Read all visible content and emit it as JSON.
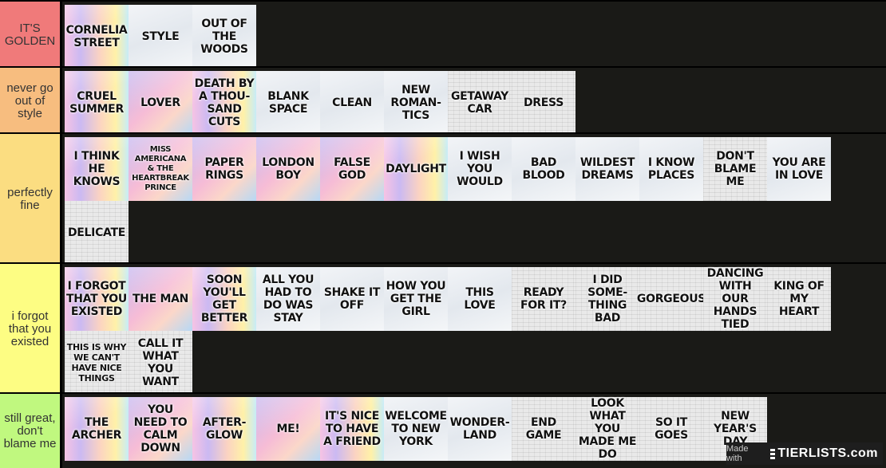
{
  "tiers": [
    {
      "label": "IT'S GOLDEN",
      "color": "#f07a7a",
      "items": [
        {
          "text": "CORNELIA STREET",
          "style": "rainbow"
        },
        {
          "text": "STYLE",
          "style": "sky"
        },
        {
          "text": "OUT OF THE WOODS",
          "style": "sky"
        }
      ]
    },
    {
      "label": "never go out of style",
      "color": "#f7bd7f",
      "items": [
        {
          "text": "CRUEL SUMMER",
          "style": "rainbow"
        },
        {
          "text": "LOVER",
          "style": "pastel"
        },
        {
          "text": "DEATH BY A THOU-SAND CUTS",
          "style": "rainbow"
        },
        {
          "text": "BLANK SPACE",
          "style": "sky"
        },
        {
          "text": "CLEAN",
          "style": "sky"
        },
        {
          "text": "NEW ROMAN-TICS",
          "style": "sky"
        },
        {
          "text": "GETAWAY CAR",
          "style": "paper"
        },
        {
          "text": "DRESS",
          "style": "paper"
        }
      ]
    },
    {
      "label": "perfectly fine",
      "color": "#fbdd81",
      "items": [
        {
          "text": "I THINK HE KNOWS",
          "style": "rainbow"
        },
        {
          "text": "MISS AMERICANA & THE HEARTBREAK PRINCE",
          "style": "pastel",
          "size": "xs"
        },
        {
          "text": "PAPER RINGS",
          "style": "pastel"
        },
        {
          "text": "LONDON BOY",
          "style": "pastel"
        },
        {
          "text": "FALSE GOD",
          "style": "pastel"
        },
        {
          "text": "DAYLIGHT",
          "style": "rainbow"
        },
        {
          "text": "I WISH YOU WOULD",
          "style": "sky"
        },
        {
          "text": "BAD BLOOD",
          "style": "sky"
        },
        {
          "text": "WILDEST DREAMS",
          "style": "sky"
        },
        {
          "text": "I KNOW PLACES",
          "style": "sky"
        },
        {
          "text": "DON'T BLAME ME",
          "style": "paper"
        },
        {
          "text": "YOU ARE IN LOVE",
          "style": "sky"
        },
        {
          "text": "DELICATE",
          "style": "paper"
        }
      ]
    },
    {
      "label": "i forgot that you existed",
      "color": "#fdfd83",
      "items": [
        {
          "text": "I FORGOT THAT YOU EXISTED",
          "style": "rainbow"
        },
        {
          "text": "THE MAN",
          "style": "pastel"
        },
        {
          "text": "SOON YOU'LL GET BETTER",
          "style": "rainbow"
        },
        {
          "text": "ALL YOU HAD TO DO WAS STAY",
          "style": "sky"
        },
        {
          "text": "SHAKE IT OFF",
          "style": "sky"
        },
        {
          "text": "HOW YOU GET THE GIRL",
          "style": "sky"
        },
        {
          "text": "THIS LOVE",
          "style": "sky"
        },
        {
          "text": "READY FOR IT?",
          "style": "paper"
        },
        {
          "text": "I DID SOME-THING BAD",
          "style": "paper"
        },
        {
          "text": "GORGEOUS",
          "style": "paper"
        },
        {
          "text": "DANCING WITH OUR HANDS TIED",
          "style": "paper"
        },
        {
          "text": "KING OF MY HEART",
          "style": "paper"
        },
        {
          "text": "THIS IS WHY WE CAN'T HAVE NICE THINGS",
          "style": "paper",
          "size": "sm"
        },
        {
          "text": "CALL IT WHAT YOU WANT",
          "style": "paper"
        }
      ]
    },
    {
      "label": "still great, don't blame me",
      "color": "#c0f87f",
      "items": [
        {
          "text": "THE ARCHER",
          "style": "rainbow"
        },
        {
          "text": "YOU NEED TO CALM DOWN",
          "style": "pastel"
        },
        {
          "text": "AFTER-GLOW",
          "style": "rainbow"
        },
        {
          "text": "ME!",
          "style": "pastel"
        },
        {
          "text": "IT'S NICE TO HAVE A FRIEND",
          "style": "rainbow"
        },
        {
          "text": "WELCOME TO NEW YORK",
          "style": "sky"
        },
        {
          "text": "WONDER-LAND",
          "style": "sky"
        },
        {
          "text": "END GAME",
          "style": "paper"
        },
        {
          "text": "LOOK WHAT YOU MADE ME DO",
          "style": "paper"
        },
        {
          "text": "SO IT GOES",
          "style": "paper"
        },
        {
          "text": "NEW YEAR'S DAY",
          "style": "paper"
        }
      ]
    }
  ],
  "watermark": {
    "made_with": "Made with",
    "brand": "TIERLISTS.com"
  }
}
